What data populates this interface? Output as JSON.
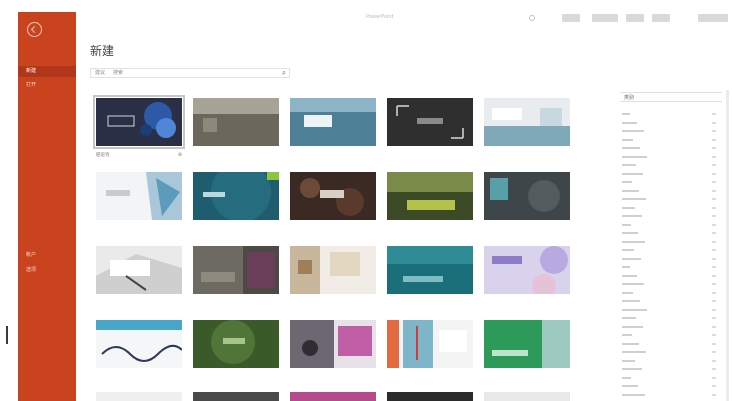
{
  "app": {
    "title": "PowerPoint"
  },
  "colors": {
    "sidebar": "#c9431f",
    "sidebar_active": "#b2361a"
  },
  "sidebar": {
    "back_label": "",
    "items": [
      {
        "label": "新建",
        "active": true
      },
      {
        "label": "打开",
        "active": false
      },
      {
        "label": "",
        "active": false
      },
      {
        "label": "",
        "active": false
      },
      {
        "label": "",
        "active": false
      },
      {
        "label": "",
        "active": false
      },
      {
        "label": "",
        "active": false
      },
      {
        "label": "",
        "active": false
      },
      {
        "label": "",
        "active": false
      },
      {
        "label": "",
        "active": false
      },
      {
        "label": "帐户",
        "active": false
      },
      {
        "label": "选项",
        "active": false
      }
    ]
  },
  "page": {
    "title": "新建"
  },
  "search": {
    "prefix": "建议",
    "value": "搜索",
    "go": "ρ"
  },
  "templates": [
    {
      "label": "肥皂泡",
      "pin": "⊕"
    },
    {
      "label": "",
      "pin": ""
    },
    {
      "label": "",
      "pin": ""
    },
    {
      "label": "",
      "pin": ""
    },
    {
      "label": "",
      "pin": ""
    },
    {
      "label": "",
      "pin": ""
    },
    {
      "label": "",
      "pin": ""
    },
    {
      "label": "",
      "pin": ""
    },
    {
      "label": "",
      "pin": ""
    },
    {
      "label": "",
      "pin": ""
    },
    {
      "label": "",
      "pin": ""
    },
    {
      "label": "",
      "pin": ""
    },
    {
      "label": "",
      "pin": ""
    },
    {
      "label": "",
      "pin": ""
    },
    {
      "label": "",
      "pin": ""
    },
    {
      "label": "",
      "pin": ""
    },
    {
      "label": "",
      "pin": ""
    },
    {
      "label": "",
      "pin": ""
    },
    {
      "label": "",
      "pin": ""
    },
    {
      "label": "",
      "pin": ""
    }
  ],
  "categories": {
    "header": "类别",
    "items": [
      {
        "name": "",
        "count": ""
      },
      {
        "name": "",
        "count": ""
      },
      {
        "name": "",
        "count": ""
      },
      {
        "name": "",
        "count": ""
      },
      {
        "name": "",
        "count": ""
      },
      {
        "name": "",
        "count": ""
      },
      {
        "name": "",
        "count": ""
      },
      {
        "name": "",
        "count": ""
      },
      {
        "name": "",
        "count": ""
      },
      {
        "name": "",
        "count": ""
      },
      {
        "name": "",
        "count": ""
      },
      {
        "name": "",
        "count": ""
      },
      {
        "name": "",
        "count": ""
      },
      {
        "name": "",
        "count": ""
      },
      {
        "name": "",
        "count": ""
      },
      {
        "name": "",
        "count": ""
      },
      {
        "name": "",
        "count": ""
      },
      {
        "name": "",
        "count": ""
      },
      {
        "name": "",
        "count": ""
      },
      {
        "name": "",
        "count": ""
      },
      {
        "name": "",
        "count": ""
      },
      {
        "name": "",
        "count": ""
      },
      {
        "name": "",
        "count": ""
      },
      {
        "name": "",
        "count": ""
      },
      {
        "name": "",
        "count": ""
      },
      {
        "name": "",
        "count": ""
      },
      {
        "name": "",
        "count": ""
      },
      {
        "name": "",
        "count": ""
      },
      {
        "name": "",
        "count": ""
      },
      {
        "name": "",
        "count": ""
      },
      {
        "name": "",
        "count": ""
      },
      {
        "name": "",
        "count": ""
      },
      {
        "name": "",
        "count": ""
      },
      {
        "name": "",
        "count": ""
      }
    ]
  }
}
